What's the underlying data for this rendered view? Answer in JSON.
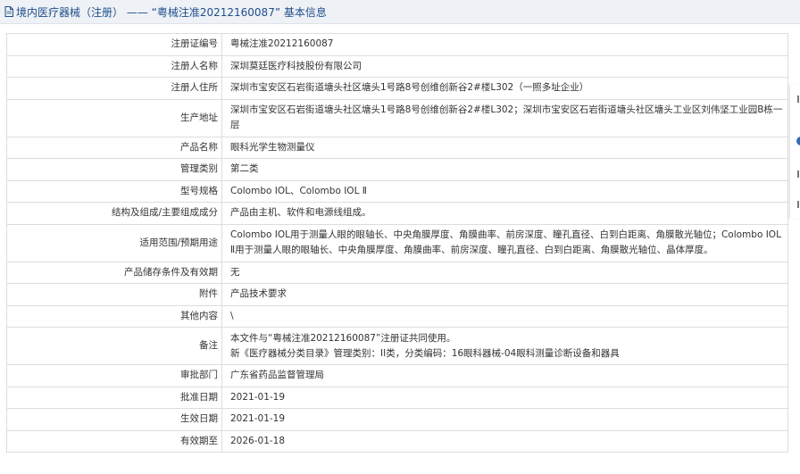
{
  "header": {
    "title": "境内医疗器械（注册） —— “粤械注准20212160087” 基本信息"
  },
  "rows": [
    {
      "label": "注册证编号",
      "value": "粤械注准20212160087"
    },
    {
      "label": "注册人名称",
      "value": "深圳莫廷医疗科技股份有限公司"
    },
    {
      "label": "注册人住所",
      "value": "深圳市宝安区石岩街道塘头社区塘头1号路8号创维创新谷2#楼L302（一照多址企业）"
    },
    {
      "label": "生产地址",
      "value": "深圳市宝安区石岩街道塘头社区塘头1号路8号创维创新谷2#楼L302；深圳市宝安区石岩街道塘头社区塘头工业区刘伟坚工业园B栋一层"
    },
    {
      "label": "产品名称",
      "value": "眼科光学生物测量仪"
    },
    {
      "label": "管理类别",
      "value": "第二类"
    },
    {
      "label": "型号规格",
      "value": "Colombo IOL、Colombo IOL Ⅱ"
    },
    {
      "label": "结构及组成/主要组成成分",
      "value": "产品由主机、软件和电源线组成。"
    },
    {
      "label": "适用范围/预期用途",
      "value": "Colombo IOL用于测量人眼的眼轴长、中央角膜厚度、角膜曲率、前房深度、瞳孔直径、白到白距离、角膜散光轴位；Colombo IOL Ⅱ用于测量人眼的眼轴长、中央角膜厚度、角膜曲率、前房深度、瞳孔直径、白到白距离、角膜散光轴位、晶体厚度。"
    },
    {
      "label": "产品储存条件及有效期",
      "value": "无"
    },
    {
      "label": "附件",
      "value": "产品技术要求"
    },
    {
      "label": "其他内容",
      "value": "\\"
    },
    {
      "label": "备注",
      "value_lines": [
        "本文件与“粤械注准20212160087”注册证共同使用。",
        "新《医疗器械分类目录》管理类别：II类，分类编码：16眼科器械-04眼科测量诊断设备和器具"
      ]
    },
    {
      "label": "审批部门",
      "value": "广东省药品监督管理局"
    },
    {
      "label": "批准日期",
      "value": "2021-01-19"
    },
    {
      "label": "生效日期",
      "value": "2021-01-19"
    },
    {
      "label": "有效期至",
      "value": "2026-01-18"
    }
  ],
  "colors": {
    "title_text": "#1f4e8c",
    "title_bg": "#eef1f5",
    "border": "#dddddd"
  },
  "icons": {
    "title_icon": "document-icon"
  }
}
